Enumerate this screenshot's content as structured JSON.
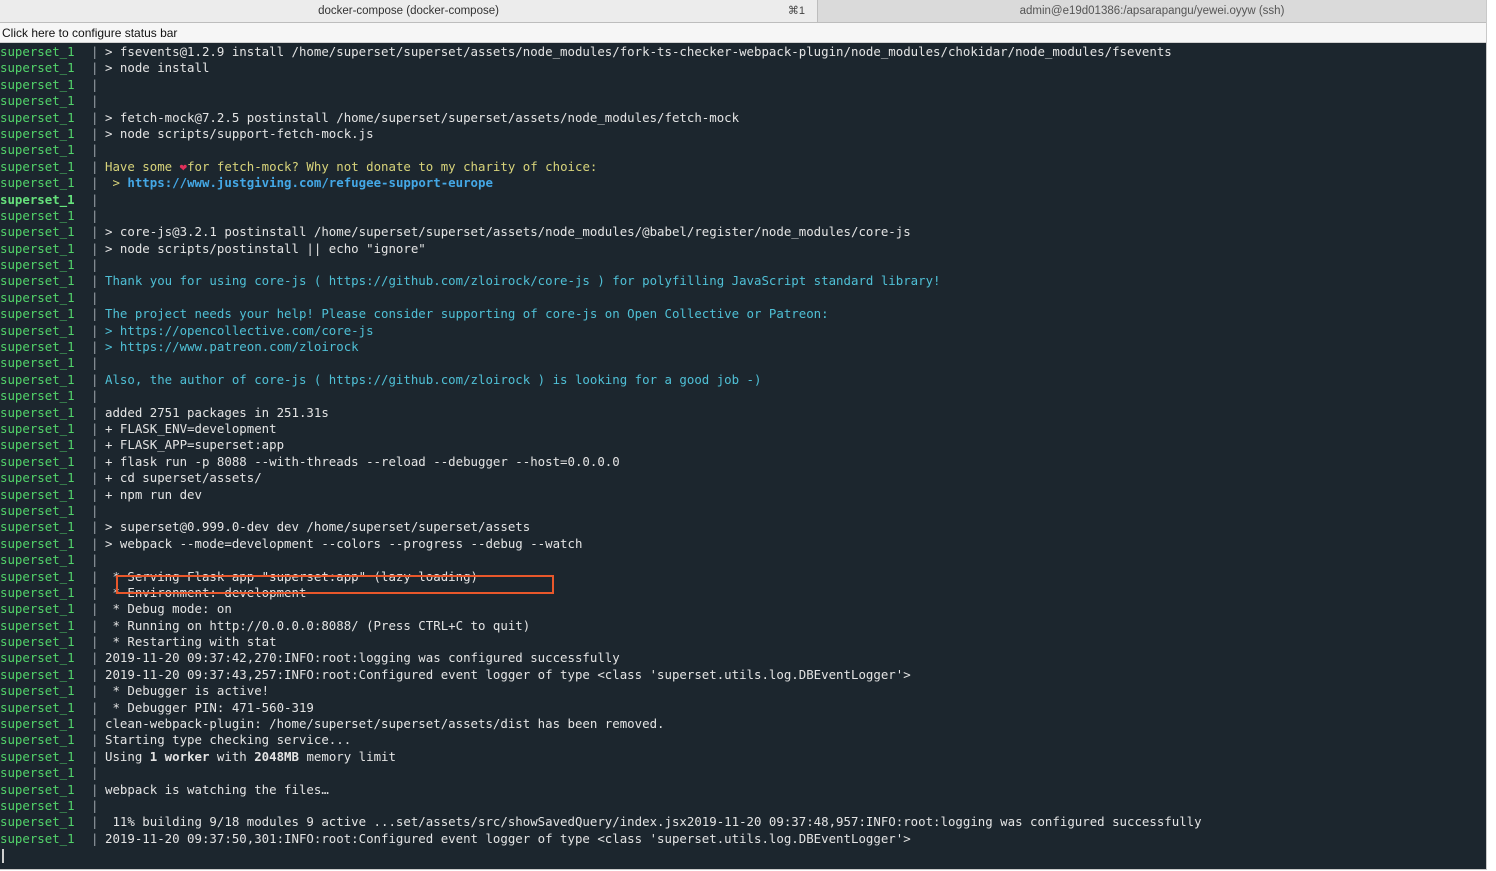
{
  "tabs": {
    "active_title": "docker-compose (docker-compose)",
    "active_shortcut": "⌘1",
    "inactive_title": "admin@e19d01386:/apsarapangu/yewei.oyyw (ssh)"
  },
  "status_bar": {
    "label": "Click here to configure status bar"
  },
  "terminal": {
    "prefix": "superset_1",
    "separator": "|",
    "lines": [
      {
        "t": "> fsevents@1.2.9 install /home/superset/superset/assets/node_modules/fork-ts-checker-webpack-plugin/node_modules/chokidar/node_modules/fsevents"
      },
      {
        "t": "> node install"
      },
      {
        "t": ""
      },
      {
        "t": ""
      },
      {
        "t": "> fetch-mock@7.2.5 postinstall /home/superset/superset/assets/node_modules/fetch-mock"
      },
      {
        "t": "> node scripts/support-fetch-mock.js"
      },
      {
        "t": ""
      },
      {
        "t": "Have some ",
        "t2": "❤",
        "t3": "for fetch-mock? Why not donate to my charity of choice:",
        "c": "yellow"
      },
      {
        "t": " > ",
        "t2": "https://www.justgiving.com/refugee-support-europe",
        "c": "link"
      },
      {
        "t": "",
        "bold": true
      },
      {
        "t": ""
      },
      {
        "t": "> core-js@3.2.1 postinstall /home/superset/superset/assets/node_modules/@babel/register/node_modules/core-js"
      },
      {
        "t": "> node scripts/postinstall || echo \"ignore\""
      },
      {
        "t": ""
      },
      {
        "t": "Thank you for using core-js ( https://github.com/zloirock/core-js ) for polyfilling JavaScript standard library!",
        "c": "cyan"
      },
      {
        "t": ""
      },
      {
        "t": "The project needs your help! Please consider supporting of core-js on Open Collective or Patreon:",
        "c": "cyan"
      },
      {
        "t": "> https://opencollective.com/core-js",
        "c": "cyan"
      },
      {
        "t": "> https://www.patreon.com/zloirock",
        "c": "cyan"
      },
      {
        "t": ""
      },
      {
        "t": "Also, the author of core-js ( https://github.com/zloirock ) is looking for a good job -)",
        "c": "cyan"
      },
      {
        "t": ""
      },
      {
        "t": "added 2751 packages in 251.31s"
      },
      {
        "t": "+ FLASK_ENV=development"
      },
      {
        "t": "+ FLASK_APP=superset:app"
      },
      {
        "t": "+ flask run -p 8088 --with-threads --reload --debugger --host=0.0.0.0"
      },
      {
        "t": "+ cd superset/assets/"
      },
      {
        "t": "+ npm run dev"
      },
      {
        "t": ""
      },
      {
        "t": "> superset@0.999.0-dev dev /home/superset/superset/assets"
      },
      {
        "t": "> webpack --mode=development --colors --progress --debug --watch"
      },
      {
        "t": ""
      },
      {
        "t": " * Serving Flask app \"superset:app\" (lazy loading)"
      },
      {
        "t": " * Environment: development"
      },
      {
        "t": " * Debug mode: on"
      },
      {
        "t": " * Running on http://0.0.0.0:8088/ (Press CTRL+C to quit)"
      },
      {
        "t": " * Restarting with stat"
      },
      {
        "t": "2019-11-20 09:37:42,270:INFO:root:logging was configured successfully"
      },
      {
        "t": "2019-11-20 09:37:43,257:INFO:root:Configured event logger of type <class 'superset.utils.log.DBEventLogger'>"
      },
      {
        "t": " * Debugger is active!"
      },
      {
        "t": " * Debugger PIN: 471-560-319"
      },
      {
        "t": "clean-webpack-plugin: /home/superset/superset/assets/dist has been removed."
      },
      {
        "t": "Starting type checking service..."
      },
      {
        "t": "Using ",
        "t2": "1 worker",
        "t3": " with ",
        "t4": "2048MB",
        "t5": " memory limit",
        "c": "mixed"
      },
      {
        "t": ""
      },
      {
        "t": "webpack is watching the files…"
      },
      {
        "t": ""
      },
      {
        "t": " 11% building 9/18 modules 9 active ...set/assets/src/showSavedQuery/index.jsx2019-11-20 09:37:48,957:INFO:root:logging was configured successfully"
      },
      {
        "t": "2019-11-20 09:37:50,301:INFO:root:Configured event logger of type <class 'superset.utils.log.DBEventLogger'>"
      }
    ]
  },
  "colors": {
    "background": "#1c262e",
    "prefix": "#52d36a",
    "highlight_box": "#e8572b"
  }
}
